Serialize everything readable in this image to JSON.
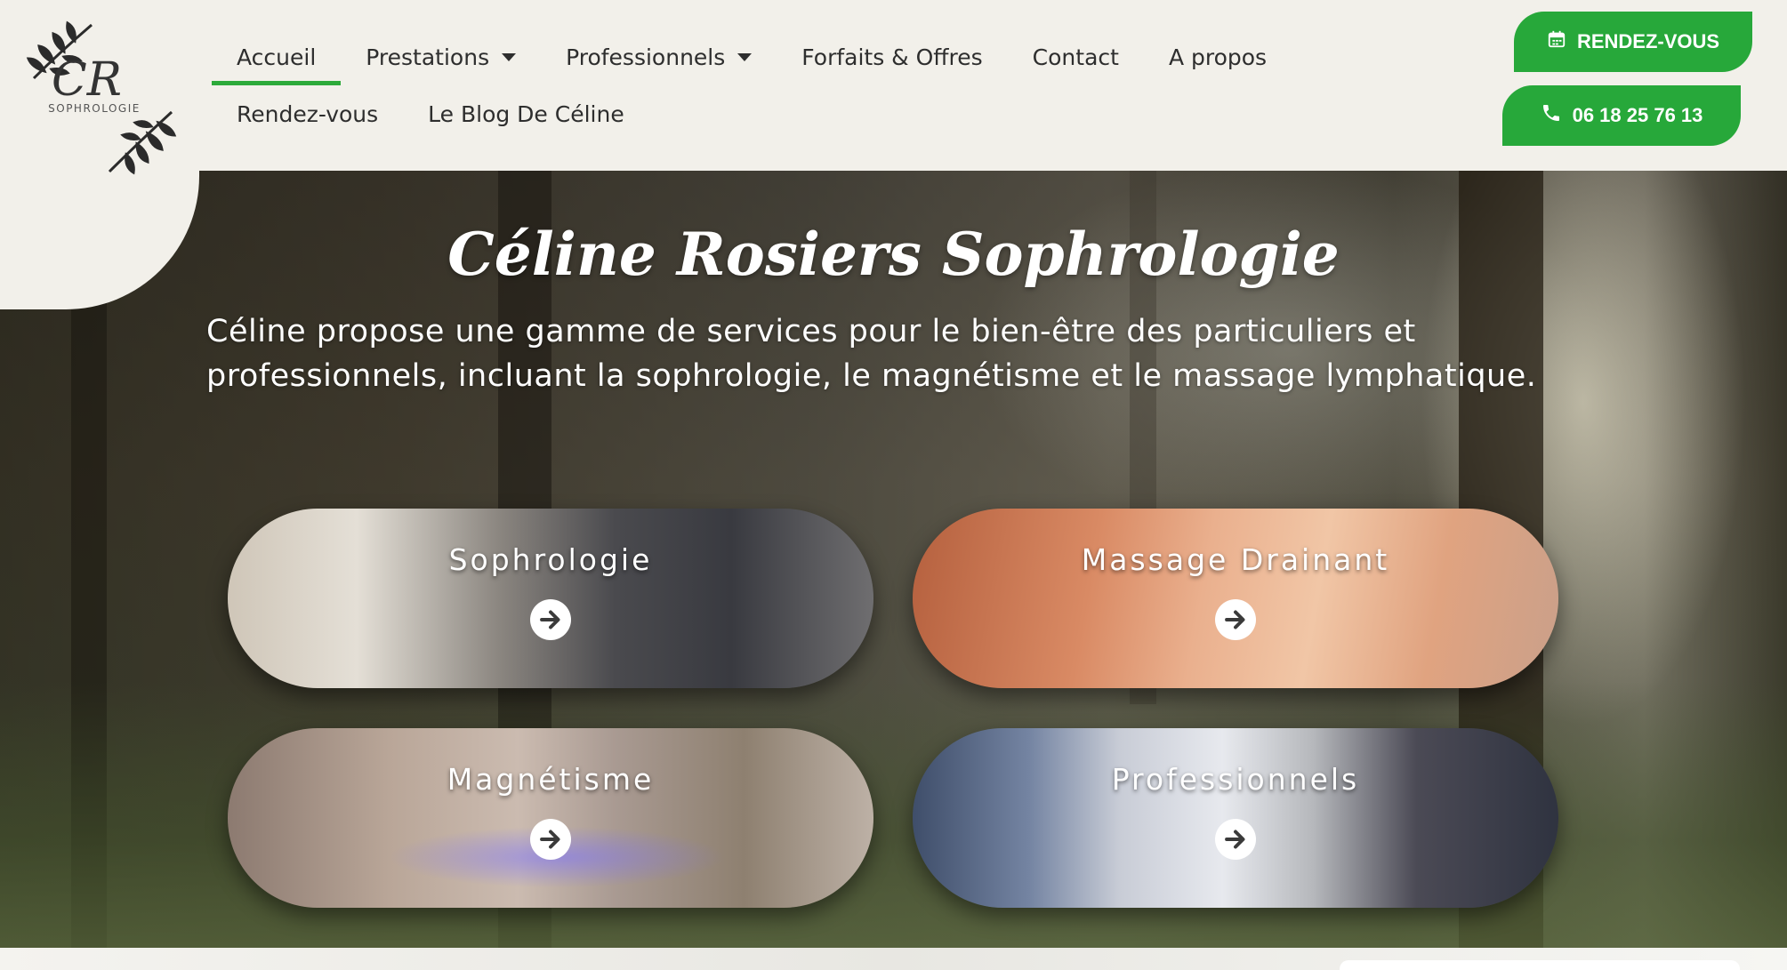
{
  "brand": {
    "logo_initials": "CR",
    "logo_subtitle": "SOPHROLOGIE"
  },
  "nav": {
    "items": [
      {
        "label": "Accueil",
        "active": true,
        "has_dropdown": false
      },
      {
        "label": "Prestations",
        "active": false,
        "has_dropdown": true
      },
      {
        "label": "Professionnels",
        "active": false,
        "has_dropdown": true
      },
      {
        "label": "Forfaits & Offres",
        "active": false,
        "has_dropdown": false
      },
      {
        "label": "Contact",
        "active": false,
        "has_dropdown": false
      },
      {
        "label": "A propos",
        "active": false,
        "has_dropdown": false
      },
      {
        "label": "Rendez-vous",
        "active": false,
        "has_dropdown": false
      },
      {
        "label": "Le Blog De Céline",
        "active": false,
        "has_dropdown": false
      }
    ]
  },
  "cta": {
    "appointment_label": "RENDEZ-VOUS",
    "phone_label": "06 18 25 76 13"
  },
  "hero": {
    "title": "Céline Rosiers Sophrologie",
    "description": "Céline propose une gamme de services pour le bien-être des particuliers et professionnels, incluant la sophrologie, le magnétisme et le massage lymphatique."
  },
  "cards": [
    {
      "label": "Sophrologie"
    },
    {
      "label": "Massage Drainant"
    },
    {
      "label": "Magnétisme"
    },
    {
      "label": "Professionnels"
    }
  ],
  "colors": {
    "accent_green": "#27a83a",
    "header_bg": "#f2f0ea",
    "nav_text": "#2e2e2e"
  },
  "icons": {
    "appointment": "calendar-icon",
    "phone": "phone-icon",
    "card_arrow": "arrow-right-circle-icon",
    "dropdown": "caret-down-icon"
  }
}
